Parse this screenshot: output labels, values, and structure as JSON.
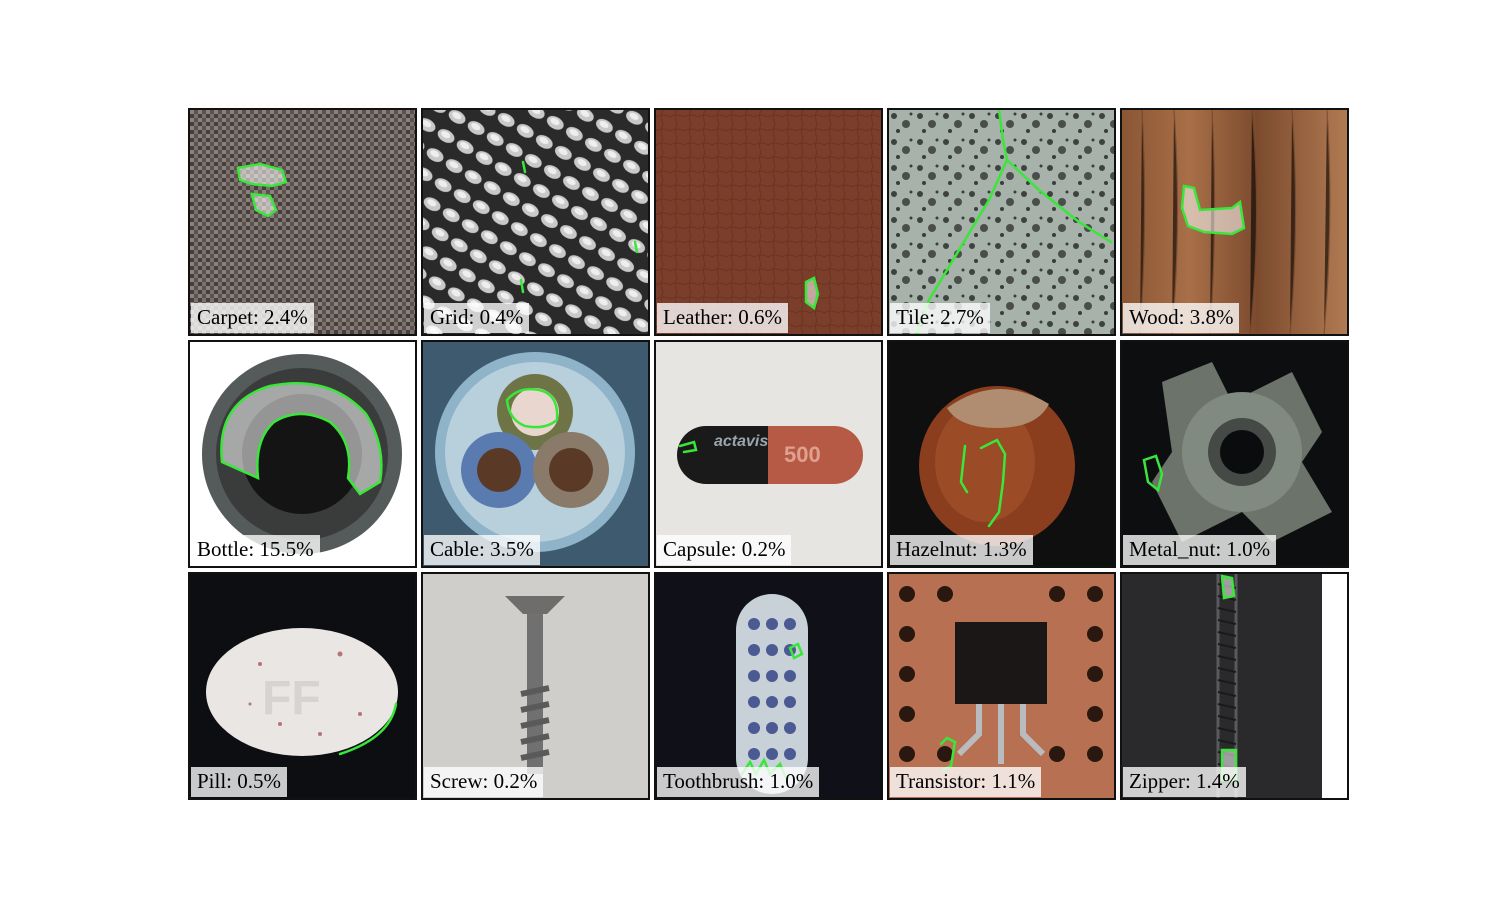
{
  "figure": {
    "tiles": [
      {
        "category": "Carpet",
        "label": "Carpet: 2.4%"
      },
      {
        "category": "Grid",
        "label": "Grid: 0.4%"
      },
      {
        "category": "Leather",
        "label": "Leather: 0.6%"
      },
      {
        "category": "Tile",
        "label": "Tile: 2.7%"
      },
      {
        "category": "Wood",
        "label": "Wood: 3.8%"
      },
      {
        "category": "Bottle",
        "label": "Bottle: 15.5%"
      },
      {
        "category": "Cable",
        "label": "Cable: 3.5%"
      },
      {
        "category": "Capsule",
        "label": "Capsule: 0.2%"
      },
      {
        "category": "Hazelnut",
        "label": "Hazelnut: 1.3%"
      },
      {
        "category": "Metal_nut",
        "label": "Metal_nut: 1.0%"
      },
      {
        "category": "Pill",
        "label": "Pill: 0.5%"
      },
      {
        "category": "Screw",
        "label": "Screw: 0.2%"
      },
      {
        "category": "Toothbrush",
        "label": "Toothbrush: 1.0%"
      },
      {
        "category": "Transistor",
        "label": "Transistor: 1.1%"
      },
      {
        "category": "Zipper",
        "label": "Zipper: 1.4%"
      }
    ],
    "capsule_print": {
      "brand": "actavis",
      "number": "500"
    },
    "pill_print": "FF",
    "colors": {
      "mask_outline": "#39e639",
      "tile_border": "#111111"
    }
  }
}
